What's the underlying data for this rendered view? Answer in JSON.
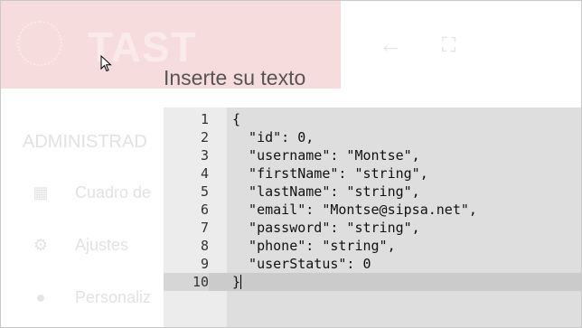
{
  "background": {
    "app_title": "TAST",
    "section_title": "ADMINISTRAD",
    "menu_items": [
      {
        "label": "Cuadro de",
        "icon": "dashboard-icon"
      },
      {
        "label": "Ajustes",
        "icon": "gear-icon"
      },
      {
        "label": "Personaliz",
        "icon": "palette-icon"
      }
    ],
    "header_icons": [
      "back-arrow-icon",
      "fullscreen-icon"
    ]
  },
  "dialog": {
    "title": "Inserte su texto"
  },
  "editor": {
    "lines": [
      {
        "num": "1",
        "text": "{"
      },
      {
        "num": "2",
        "text": "  \"id\": 0,"
      },
      {
        "num": "3",
        "text": "  \"username\": \"Montse\","
      },
      {
        "num": "4",
        "text": "  \"firstName\": \"string\","
      },
      {
        "num": "5",
        "text": "  \"lastName\": \"string\","
      },
      {
        "num": "6",
        "text": "  \"email\": \"Montse@sipsa.net\","
      },
      {
        "num": "7",
        "text": "  \"password\": \"string\","
      },
      {
        "num": "8",
        "text": "  \"phone\": \"string\","
      },
      {
        "num": "9",
        "text": "  \"userStatus\": 0"
      },
      {
        "num": "10",
        "text": "}"
      }
    ],
    "active_line": 10
  }
}
